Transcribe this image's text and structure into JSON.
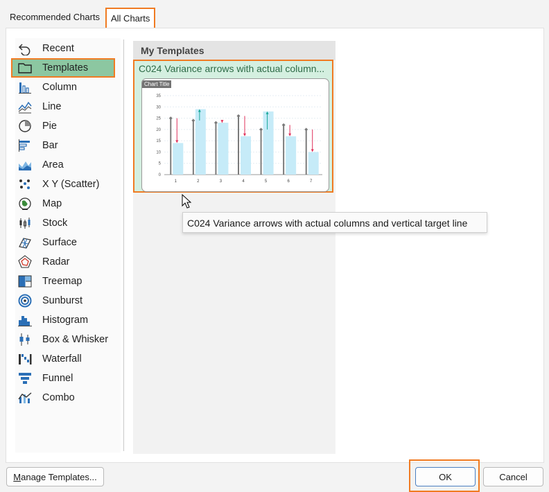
{
  "tabs": {
    "recommended": "Recommended Charts",
    "all": "All Charts"
  },
  "sidebar": {
    "items": [
      {
        "label": "Recent",
        "icon": "recent-icon"
      },
      {
        "label": "Templates",
        "icon": "folder-icon",
        "selected": true
      },
      {
        "label": "Column",
        "icon": "column-chart-icon"
      },
      {
        "label": "Line",
        "icon": "line-chart-icon"
      },
      {
        "label": "Pie",
        "icon": "pie-chart-icon"
      },
      {
        "label": "Bar",
        "icon": "bar-chart-icon"
      },
      {
        "label": "Area",
        "icon": "area-chart-icon"
      },
      {
        "label": "X Y (Scatter)",
        "icon": "scatter-chart-icon"
      },
      {
        "label": "Map",
        "icon": "map-chart-icon"
      },
      {
        "label": "Stock",
        "icon": "stock-chart-icon"
      },
      {
        "label": "Surface",
        "icon": "surface-chart-icon"
      },
      {
        "label": "Radar",
        "icon": "radar-chart-icon"
      },
      {
        "label": "Treemap",
        "icon": "treemap-chart-icon"
      },
      {
        "label": "Sunburst",
        "icon": "sunburst-chart-icon"
      },
      {
        "label": "Histogram",
        "icon": "histogram-chart-icon"
      },
      {
        "label": "Box & Whisker",
        "icon": "box-whisker-chart-icon"
      },
      {
        "label": "Waterfall",
        "icon": "waterfall-chart-icon"
      },
      {
        "label": "Funnel",
        "icon": "funnel-chart-icon"
      },
      {
        "label": "Combo",
        "icon": "combo-chart-icon"
      }
    ]
  },
  "content": {
    "section_title": "My Templates",
    "template": {
      "name": "C024 Variance arrows with actual column...",
      "tooltip": "C024 Variance arrows with actual columns and vertical target line"
    }
  },
  "chart_data": {
    "type": "bar",
    "title": "Chart Title",
    "categories": [
      "1",
      "2",
      "3",
      "4",
      "5",
      "6",
      "7"
    ],
    "series": [
      {
        "values": [
          14,
          29,
          23,
          17,
          28,
          17,
          10
        ]
      },
      {
        "values": [
          25,
          24,
          23,
          26,
          20,
          22,
          20
        ]
      }
    ],
    "y_ticks": [
      0,
      5,
      10,
      15,
      20,
      25,
      30,
      35
    ],
    "ylim": [
      0,
      35
    ],
    "grid": true,
    "colors": {
      "actual": "#c6ebf8",
      "target": "#7a7a7a",
      "up": "#1aa89a",
      "down": "#e0305a"
    }
  },
  "buttons": {
    "manage_prefix": "",
    "manage_underline": "M",
    "manage_rest": "anage Templates...",
    "ok": "OK",
    "cancel": "Cancel"
  },
  "colors": {
    "accent_highlight": "#f07b22",
    "selected_bg": "#8cc7a1",
    "template_bg": "#d4efe0"
  }
}
